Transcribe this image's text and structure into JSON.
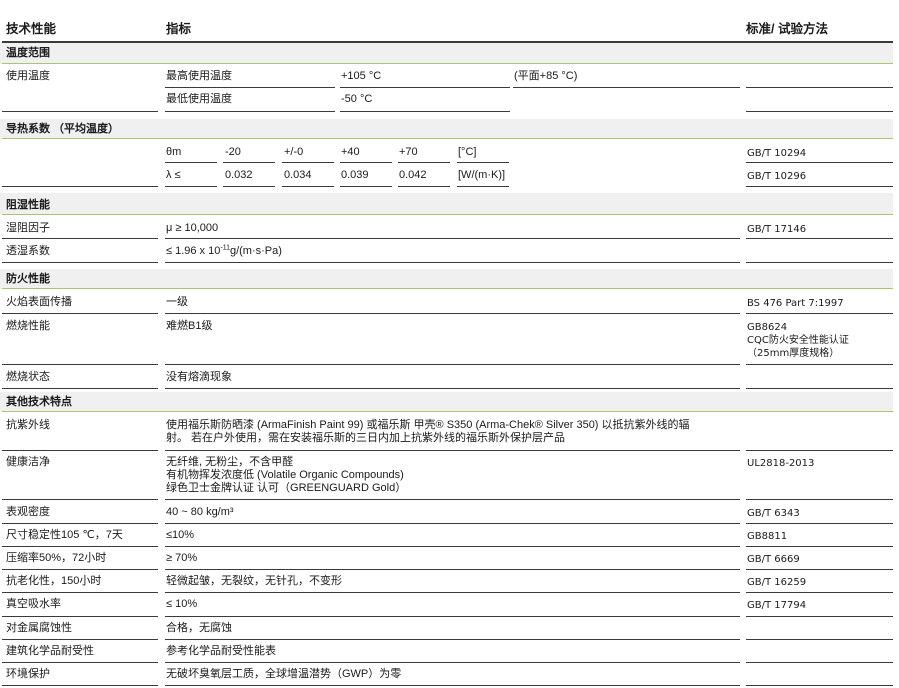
{
  "header": {
    "col1": "技术性能",
    "col2": "指标",
    "col3": "标准/ 试验方法"
  },
  "temp": {
    "title": "温度范围",
    "label": "使用温度",
    "max_label": "最高使用温度",
    "max_val": "+105 °C",
    "max_note": "(平面+85 °C)",
    "min_label": "最低使用温度",
    "min_val": "-50 °C"
  },
  "thermal": {
    "title": "导热系数 （平均温度）",
    "row1": {
      "c0": "θm",
      "c1": "-20",
      "c2": "+/-0",
      "c3": "+40",
      "c4": "+70",
      "unit": "[°C]",
      "std": "GB/T 10294"
    },
    "row2": {
      "c0": "λ ≤",
      "c1": "0.032",
      "c2": "0.034",
      "c3": "0.039",
      "c4": "0.042",
      "unit": "[W/(m·K)]",
      "std": "GB/T 10296"
    }
  },
  "moisture": {
    "title": "阻湿性能",
    "r1": {
      "label": "湿阻因子",
      "value": "μ ≥ 10,000",
      "std": "GB/T 17146"
    },
    "r2": {
      "label": "透湿系数",
      "value_pre": "≤ 1.96 x 10",
      "value_sup": "-11",
      "value_post": "g/(m·s·Pa)"
    }
  },
  "fire": {
    "title": "防火性能",
    "r1": {
      "label": "火焰表面传播",
      "value": "一级",
      "std": "BS 476 Part 7:1997"
    },
    "r2": {
      "label": "燃烧性能",
      "value": "难燃B1级",
      "std1": "GB8624",
      "std2": "CQC防火安全性能认证",
      "std3": "（25mm厚度规格）"
    },
    "r3": {
      "label": "燃烧状态",
      "value": "没有熔滴现象"
    }
  },
  "other": {
    "title": "其他技术特点",
    "uv": {
      "label": "抗紫外线",
      "line1": "使用福乐斯防晒漆 (ArmaFinish Paint 99) 或福乐斯 甲壳® S350 (Arma-Chek® Silver 350) 以抵抗紫外线的辐",
      "line2": "射。 若在户外使用，需在安装福乐斯的三日内加上抗紫外线的福乐斯外保护层产品"
    },
    "health": {
      "label": "健康洁净",
      "line1": "无纤维, 无粉尘，不含甲醛",
      "line2": "有机物挥发浓度低 (Volatile Organic Compounds)",
      "line3": "绿色卫士金牌认证 认可（GREENGUARD Gold）",
      "std": "UL2818-2013"
    },
    "rows": [
      {
        "label": "表观密度",
        "value": "40 ~ 80 kg/m³",
        "std": "GB/T 6343"
      },
      {
        "label": "尺寸稳定性105 ℃，7天",
        "value": "≤10%",
        "std": "GB8811"
      },
      {
        "label": "压缩率50%，72小时",
        "value": "≥ 70%",
        "std": "GB/T 6669"
      },
      {
        "label": "抗老化性，150小时",
        "value": "轻微起皱，无裂纹，无针孔，不变形",
        "std": "GB/T 16259"
      },
      {
        "label": "真空吸水率",
        "value": "≤ 10%",
        "std": "GB/T 17794"
      },
      {
        "label": "对金属腐蚀性",
        "value": "合格，无腐蚀",
        "std": ""
      },
      {
        "label": "建筑化学品耐受性",
        "value": "参考化学品耐受性能表",
        "std": ""
      },
      {
        "label": "环境保护",
        "value": "无破坏臭氧层工质，全球增温潜势（GWP）为零",
        "std": ""
      }
    ]
  }
}
